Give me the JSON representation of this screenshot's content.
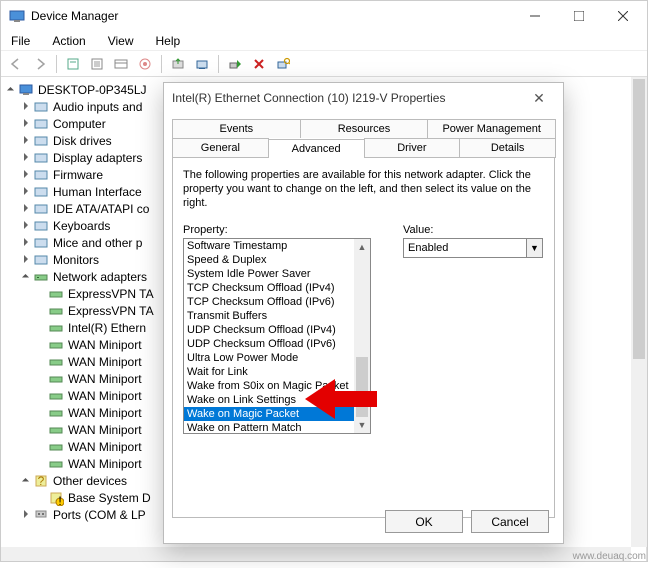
{
  "window": {
    "title": "Device Manager",
    "menu": [
      "File",
      "Action",
      "View",
      "Help"
    ]
  },
  "tree": {
    "root": "DESKTOP-0P345LJ",
    "items": [
      {
        "label": "Audio inputs and",
        "icon": "audio",
        "exp": true
      },
      {
        "label": "Computer",
        "icon": "computer",
        "exp": true
      },
      {
        "label": "Disk drives",
        "icon": "disk",
        "exp": true
      },
      {
        "label": "Display adapters",
        "icon": "display",
        "exp": true
      },
      {
        "label": "Firmware",
        "icon": "chip",
        "exp": true
      },
      {
        "label": "Human Interface",
        "icon": "hid",
        "exp": true
      },
      {
        "label": "IDE ATA/ATAPI co",
        "icon": "ide",
        "exp": true
      },
      {
        "label": "Keyboards",
        "icon": "keyboard",
        "exp": true
      },
      {
        "label": "Mice and other p",
        "icon": "mouse",
        "exp": true
      },
      {
        "label": "Monitors",
        "icon": "monitor",
        "exp": true
      }
    ],
    "network": {
      "label": "Network adapters",
      "children": [
        "ExpressVPN TA",
        "ExpressVPN TA",
        "Intel(R) Ethern",
        "WAN Miniport",
        "WAN Miniport",
        "WAN Miniport",
        "WAN Miniport",
        "WAN Miniport",
        "WAN Miniport",
        "WAN Miniport",
        "WAN Miniport"
      ]
    },
    "other": {
      "label": "Other devices",
      "children": [
        "Base System D"
      ]
    },
    "last": {
      "label": "Ports (COM & LP",
      "exp": true
    }
  },
  "dialog": {
    "title": "Intel(R) Ethernet Connection (10) I219-V Properties",
    "tabs_back": [
      "Events",
      "Resources",
      "Power Management"
    ],
    "tabs_front": [
      "General",
      "Advanced",
      "Driver",
      "Details"
    ],
    "active_tab": "Advanced",
    "description": "The following properties are available for this network adapter. Click the property you want to change on the left, and then select its value on the right.",
    "property_label": "Property:",
    "value_label": "Value:",
    "properties": [
      "Software Timestamp",
      "Speed & Duplex",
      "System Idle Power Saver",
      "TCP Checksum Offload (IPv4)",
      "TCP Checksum Offload (IPv6)",
      "Transmit Buffers",
      "UDP Checksum Offload (IPv4)",
      "UDP Checksum Offload (IPv6)",
      "Ultra Low Power Mode",
      "Wait for Link",
      "Wake from S0ix on Magic Packet",
      "Wake on Link Settings",
      "Wake on Magic Packet",
      "Wake on Pattern Match"
    ],
    "selected_property": "Wake on Magic Packet",
    "value": "Enabled",
    "ok": "OK",
    "cancel": "Cancel"
  },
  "watermark": "www.deuaq.com"
}
